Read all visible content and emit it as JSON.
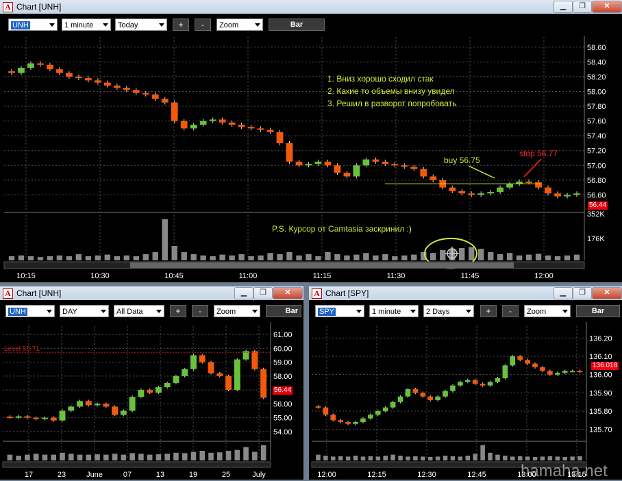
{
  "main": {
    "title": "Chart [UNH]",
    "symbol": "UNH",
    "interval": "1 minute",
    "range": "Today",
    "plus": "+",
    "minus": "-",
    "zoom": "Zoom",
    "bar": "Bar",
    "price_ticks": [
      "58.60",
      "58.40",
      "58.20",
      "58.00",
      "57.80",
      "57.60",
      "57.40",
      "57.20",
      "57.00",
      "56.80",
      "56.60"
    ],
    "last_price": "56.44",
    "volume_ticks": [
      "352K",
      "176K"
    ],
    "time_ticks": [
      "10:15",
      "10:30",
      "10:45",
      "11:00",
      "11:15",
      "11:30",
      "11:45",
      "12:00"
    ],
    "notes": [
      "1. Вниз хорошо сходил стак",
      "2. Какие то объемы внизу увидел",
      "3. Решил в разворот попробовать"
    ],
    "buy_label": "buy 56.75",
    "stop_label": "stop 56.77",
    "ps_note": "P.S. Курсор от Camtasia заскринил :)"
  },
  "daily": {
    "title": "Chart [UNH]",
    "symbol": "UNH",
    "interval": "DAY",
    "range": "All Data",
    "plus": "+",
    "minus": "-",
    "zoom": "Zoom",
    "bar": "Bar",
    "level_label": "Level 59.71",
    "price_ticks": [
      "61.00",
      "60.00",
      "59.00",
      "58.00",
      "57.00",
      "56.00",
      "55.00",
      "54.00"
    ],
    "last_price": "56.44",
    "date_ticks": [
      "17",
      "23",
      "June",
      "07",
      "13",
      "19",
      "25",
      "July"
    ]
  },
  "spy": {
    "title": "Chart [SPY]",
    "symbol": "SPY",
    "interval": "1 minute",
    "range": "2 Days",
    "plus": "+",
    "minus": "-",
    "zoom": "Zoom",
    "bar": "Bar",
    "price_ticks": [
      "136.20",
      "136.10",
      "136.00",
      "135.90",
      "135.80",
      "135.70"
    ],
    "last_price": "136.018",
    "time_ticks": [
      "12:00",
      "12:15",
      "12:30",
      "12:45",
      "13:00",
      "13:15"
    ]
  },
  "watermark": "hamaha.net",
  "chart_data": [
    {
      "type": "candlestick",
      "name": "UNH 1 minute Today",
      "ylim": [
        56.4,
        58.7
      ],
      "x_ticks": [
        "10:15",
        "10:30",
        "10:45",
        "11:00",
        "11:15",
        "11:30",
        "11:45",
        "12:00"
      ],
      "close_path": [
        58.25,
        58.32,
        58.38,
        58.36,
        58.3,
        58.25,
        58.2,
        58.18,
        58.15,
        58.12,
        58.08,
        58.05,
        58.02,
        57.98,
        57.96,
        57.9,
        57.85,
        57.6,
        57.5,
        57.55,
        57.6,
        57.62,
        57.58,
        57.55,
        57.52,
        57.5,
        57.48,
        57.45,
        57.3,
        57.05,
        57.0,
        57.02,
        57.05,
        57.0,
        56.9,
        56.85,
        57.0,
        57.08,
        57.05,
        57.02,
        57.0,
        56.98,
        56.95,
        56.85,
        56.8,
        56.7,
        56.65,
        56.62,
        56.6,
        56.62,
        56.64,
        56.7,
        56.75,
        56.78,
        56.77,
        56.7,
        56.62,
        56.58,
        56.6,
        56.62
      ],
      "volume_path": [
        0.1,
        0.12,
        0.1,
        0.08,
        0.1,
        0.12,
        0.1,
        0.15,
        0.1,
        0.12,
        0.14,
        0.1,
        0.12,
        0.1,
        0.15,
        0.2,
        1.0,
        0.35,
        0.2,
        0.15,
        0.12,
        0.1,
        0.14,
        0.12,
        0.15,
        0.1,
        0.12,
        0.18,
        0.15,
        0.2,
        0.12,
        0.15,
        0.1,
        0.2,
        0.15,
        0.12,
        0.14,
        0.18,
        0.12,
        0.15,
        0.1,
        0.12,
        0.14,
        0.2,
        0.18,
        0.25,
        0.28,
        0.3,
        0.32,
        0.28,
        0.2,
        0.15,
        0.18,
        0.12,
        0.14,
        0.16,
        0.12,
        0.1,
        0.12,
        0.14
      ],
      "annotations": {
        "buy": 56.75,
        "stop": 56.77
      }
    },
    {
      "type": "candlestick",
      "name": "UNH DAY All Data",
      "ylim": [
        53.5,
        61.4
      ],
      "x_ticks": [
        "17",
        "23",
        "June",
        "07",
        "13",
        "19",
        "25",
        "July"
      ],
      "close_path": [
        55.0,
        55.1,
        55.0,
        54.9,
        55.0,
        54.8,
        55.5,
        55.8,
        56.2,
        55.9,
        56.0,
        55.8,
        55.2,
        55.5,
        56.5,
        57.0,
        56.8,
        57.2,
        57.5,
        58.0,
        58.5,
        59.5,
        59.0,
        58.2,
        58.0,
        57.0,
        59.2,
        59.8,
        58.5,
        56.44
      ],
      "volume_path": [
        0.3,
        0.25,
        0.3,
        0.35,
        0.3,
        0.3,
        0.4,
        0.35,
        0.3,
        0.3,
        0.32,
        0.3,
        0.35,
        0.3,
        0.38,
        0.35,
        0.3,
        0.32,
        0.35,
        0.4,
        0.38,
        0.45,
        0.5,
        0.4,
        0.42,
        0.5,
        0.55,
        0.7,
        0.45,
        0.8
      ],
      "level": 59.71
    },
    {
      "type": "candlestick",
      "name": "SPY 1 minute 2 Days",
      "ylim": [
        135.65,
        136.25
      ],
      "x_ticks": [
        "12:00",
        "12:15",
        "12:30",
        "12:45",
        "13:00",
        "13:15"
      ],
      "close_path": [
        135.82,
        135.78,
        135.75,
        135.74,
        135.73,
        135.74,
        135.76,
        135.78,
        135.8,
        135.82,
        135.85,
        135.88,
        135.92,
        135.9,
        135.88,
        135.86,
        135.88,
        135.91,
        135.94,
        135.96,
        135.97,
        135.95,
        135.94,
        135.96,
        135.98,
        136.05,
        136.1,
        136.08,
        136.06,
        136.04,
        136.02,
        136.0,
        136.01,
        136.02,
        136.02,
        136.018
      ],
      "volume_path": [
        0.3,
        0.25,
        0.2,
        0.22,
        0.2,
        0.25,
        0.2,
        0.22,
        0.2,
        0.25,
        0.3,
        0.25,
        0.2,
        0.22,
        0.2,
        0.18,
        0.2,
        0.25,
        0.22,
        0.2,
        0.25,
        0.35,
        0.8,
        0.4,
        0.3,
        0.25,
        0.2,
        0.22,
        0.2,
        0.18,
        0.2,
        0.22,
        0.2,
        0.18,
        0.2,
        0.22
      ]
    }
  ]
}
